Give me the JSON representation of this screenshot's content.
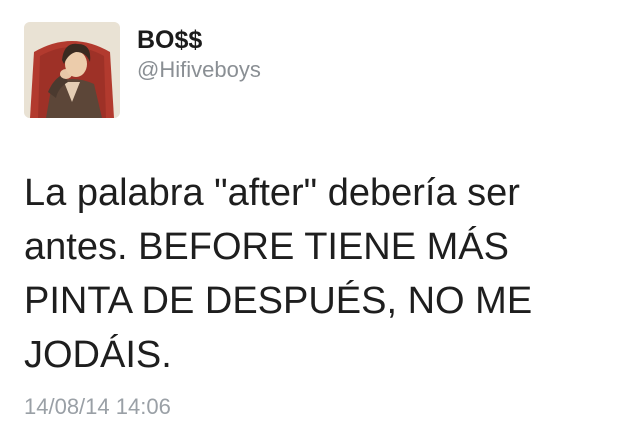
{
  "tweet": {
    "author": {
      "display_name": "BO$$",
      "handle": "@Hifiveboys",
      "avatar_icon": "profile-photo"
    },
    "text_lines": [
      "La palabra \"after\" debería ser",
      "antes. BEFORE TIENE MÁS",
      "PINTA DE DESPUÉS, NO ME",
      "JODÁIS."
    ],
    "timestamp": "14/08/14 14:06"
  },
  "colors": {
    "name": "#1b1b1b",
    "handle": "#8a8f94",
    "text": "#1e1e1e",
    "timestamp": "#9aa0a6",
    "background": "#ffffff"
  }
}
